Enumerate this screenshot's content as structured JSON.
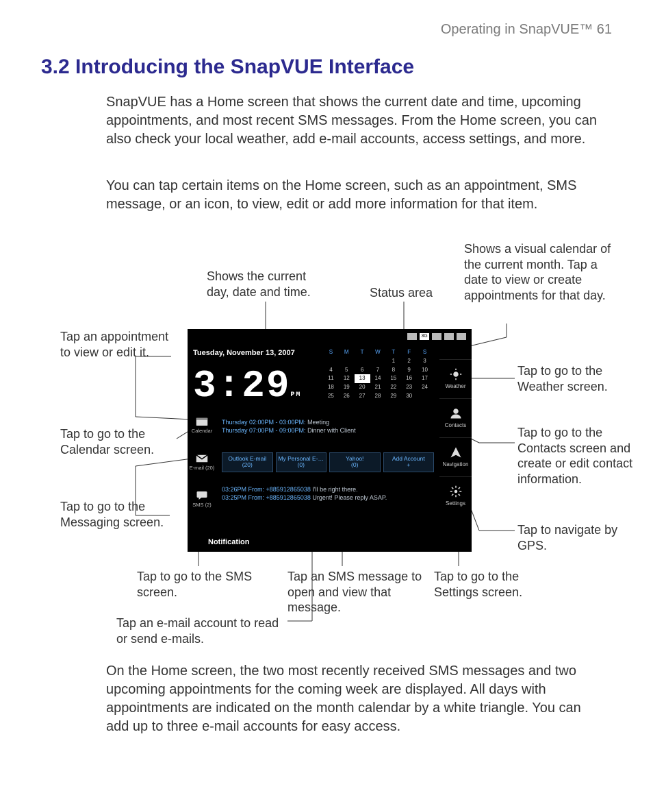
{
  "header": "Operating in SnapVUE™  61",
  "title": "3.2  Introducing the SnapVUE Interface",
  "para1": "SnapVUE has a Home screen that shows the current date and time, upcoming appointments, and most recent SMS messages. From the Home screen, you can also check your local weather, add e-mail accounts, access settings, and more.",
  "para2": "You can tap certain items on the Home screen, such as an appointment, SMS message, or an icon, to view, edit or add more information for that item.",
  "para3": "On the Home screen, the two most recently received SMS messages and two upcoming appointments for the coming week are displayed. All days with appointments are indicated on the month calendar by a white triangle. You can add up to three e-mail accounts for easy access.",
  "callouts": {
    "datetime": "Shows the current day, date and time.",
    "status": "Status area",
    "visualcal": "Shows a visual calendar of the current month. Tap a date to view or create appointments for that day.",
    "appt": "Tap an appointment to view or edit it.",
    "calendar": "Tap to go to the Calendar screen.",
    "messaging": "Tap to go to the Messaging screen.",
    "sms": "Tap to go to the SMS screen.",
    "emailacct": "Tap an e-mail account to read or send e-mails.",
    "smsmsg": "Tap an SMS message to open and view that message.",
    "settings": "Tap to go to the Settings screen.",
    "gps": "Tap to navigate by GPS.",
    "contacts": "Tap to go to the Contacts screen and create or edit contact information.",
    "weather": "Tap to go to the Weather screen."
  },
  "device": {
    "date": "Tuesday, November 13, 2007",
    "time": "3:29",
    "ampm": "PM",
    "calendar": {
      "dow": [
        "S",
        "M",
        "T",
        "W",
        "T",
        "F",
        "S"
      ],
      "rows": [
        [
          "",
          "",
          "",
          "",
          "1",
          "2",
          "3"
        ],
        [
          "4",
          "5",
          "6",
          "7",
          "8",
          "9",
          "10"
        ],
        [
          "11",
          "12",
          "13",
          "14",
          "15",
          "16",
          "17"
        ],
        [
          "18",
          "19",
          "20",
          "21",
          "22",
          "23",
          "24"
        ],
        [
          "25",
          "26",
          "27",
          "28",
          "29",
          "30",
          ""
        ]
      ],
      "today": "13"
    },
    "side": {
      "weather": "Weather",
      "contacts": "Contacts",
      "navigation": "Navigation",
      "settings": "Settings"
    },
    "left": {
      "calendar": "Calendar",
      "email": "E-mail (20)",
      "sms": "SMS (2)"
    },
    "appts": [
      {
        "when": "Thursday  02:00PM - 03:00PM:",
        "what": " Meeting"
      },
      {
        "when": "Thursday  07:00PM - 09:00PM:",
        "what": " Dinner with Client"
      }
    ],
    "email_tabs": [
      {
        "l1": "Outlook E-mail",
        "l2": "(20)"
      },
      {
        "l1": "My Personal E-…",
        "l2": "(0)"
      },
      {
        "l1": "Yahoo!",
        "l2": "(0)"
      },
      {
        "l1": "Add Account",
        "l2": "+"
      }
    ],
    "sms_msgs": [
      {
        "when": "03:26PM From: +885912865038",
        "what": " I'll be right there."
      },
      {
        "when": "03:25PM From: +885912865038",
        "what": " Urgent! Please reply ASAP."
      }
    ],
    "notification": "Notification"
  }
}
